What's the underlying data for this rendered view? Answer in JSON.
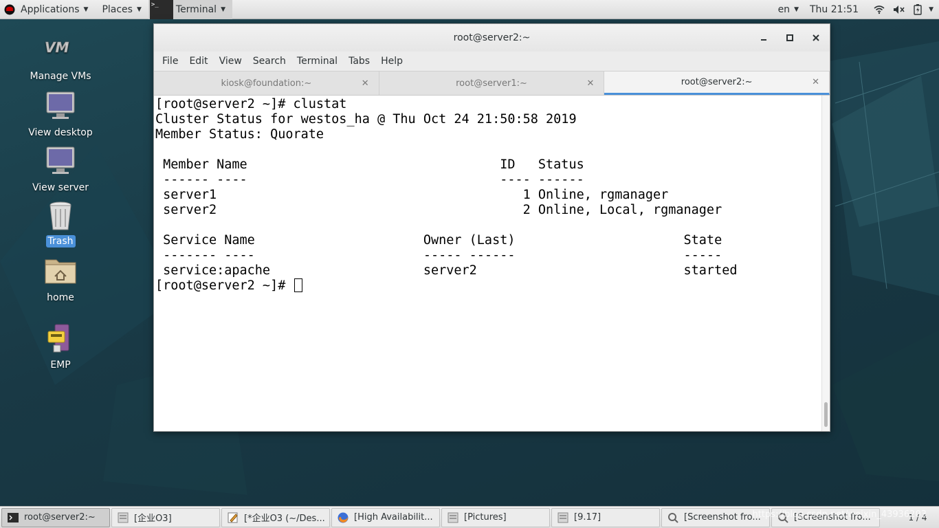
{
  "top_bar": {
    "applications": "Applications",
    "places": "Places",
    "terminal": "Terminal",
    "lang": "en",
    "clock": "Thu 21:51"
  },
  "desktop_icons": [
    {
      "label": "Manage VMs",
      "icon": "vm-icon"
    },
    {
      "label": "View desktop",
      "icon": "monitor-icon"
    },
    {
      "label": "View server",
      "icon": "monitor-icon"
    },
    {
      "label": "Trash",
      "icon": "trash-icon"
    },
    {
      "label": "home",
      "icon": "home-folder-icon"
    },
    {
      "label": "EMP",
      "icon": "emp-icon"
    }
  ],
  "window": {
    "title": "root@server2:~",
    "menu": [
      "File",
      "Edit",
      "View",
      "Search",
      "Terminal",
      "Tabs",
      "Help"
    ],
    "tabs": [
      {
        "label": "kiosk@foundation:~",
        "active": false
      },
      {
        "label": "root@server1:~",
        "active": false
      },
      {
        "label": "root@server2:~",
        "active": true
      }
    ],
    "terminal_lines": [
      "[root@server2 ~]# clustat",
      "Cluster Status for westos_ha @ Thu Oct 24 21:50:58 2019",
      "Member Status: Quorate",
      "",
      " Member Name                                 ID   Status",
      " ------ ----                                 ---- ------",
      " server1                                        1 Online, rgmanager",
      " server2                                        2 Online, Local, rgmanager",
      "",
      " Service Name                      Owner (Last)                      State",
      " ------- ----                      ----- ------                      -----",
      " service:apache                    server2                           started"
    ],
    "prompt": "[root@server2 ~]# "
  },
  "taskbar": {
    "items": [
      {
        "label": "root@server2:~",
        "active": true,
        "icon": "terminal-icon"
      },
      {
        "label": "[企业O3]",
        "active": false,
        "icon": "window-icon"
      },
      {
        "label": "[*企业O3 (~/Des...",
        "active": false,
        "icon": "editor-icon"
      },
      {
        "label": "[High Availabilit...",
        "active": false,
        "icon": "firefox-icon"
      },
      {
        "label": "[Pictures]",
        "active": false,
        "icon": "window-icon"
      },
      {
        "label": "[9.17]",
        "active": false,
        "icon": "window-icon"
      },
      {
        "label": "[Screenshot fro...",
        "active": false,
        "icon": "screenshot-icon"
      },
      {
        "label": "[Screenshot fro...",
        "active": false,
        "icon": "screenshot-icon"
      }
    ],
    "workspace": "1 / 4"
  },
  "watermark": "https://blog.csdn.net/weixin_43936203"
}
